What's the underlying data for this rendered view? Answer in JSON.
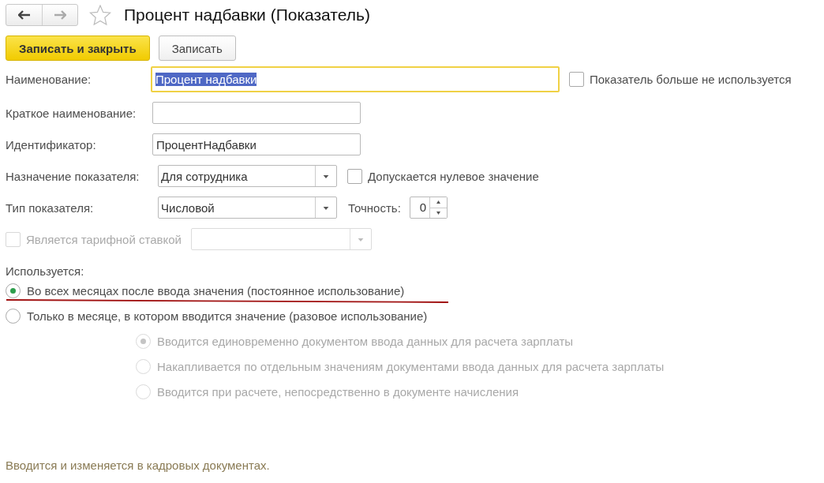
{
  "window": {
    "title": "Процент надбавки (Показатель)",
    "favorite": false
  },
  "buttons": [
    {
      "label": "Записать и закрыть",
      "kind": "primary"
    },
    {
      "label": "Записать",
      "kind": "default"
    }
  ],
  "name": {
    "label": "Наименование:",
    "value": "Процент надбавки",
    "focused": true,
    "text_selected": true
  },
  "not_used": {
    "label": "Показатель больше не используется",
    "checked": false
  },
  "short_name": {
    "label": "Краткое наименование:"
  },
  "identifier": {
    "label": "Идентификатор:",
    "value": "ПроцентНадбавки"
  },
  "purpose": {
    "label": "Назначение показателя:",
    "value": "Для сотрудника"
  },
  "zero_allowed": {
    "label": "Допускается нулевое значение",
    "checked": false
  },
  "type": {
    "label": "Тип показателя:",
    "value": "Числовой"
  },
  "precision": {
    "label": "Точность:",
    "value": "0"
  },
  "tariff": {
    "label": "Является тарифной ставкой",
    "checked": false,
    "disabled": true
  },
  "usage": {
    "label": "Используется:",
    "options": [
      {
        "label": "Во всех месяцах после ввода значения (постоянное использование)",
        "selected": true,
        "underlined": true
      },
      {
        "label": "Только в месяце, в котором вводится значение (разовое использование)",
        "selected": false,
        "underlined": false
      }
    ]
  },
  "entry_mode": {
    "disabled": true,
    "options": [
      {
        "label": "Вводится единовременно документом ввода данных для расчета зарплаты",
        "selected": true
      },
      {
        "label": "Накапливается по отдельным значениям документами ввода данных для расчета зарплаты",
        "selected": false
      },
      {
        "label": "Вводится при расчете, непосредственно в документе начисления",
        "selected": false
      }
    ]
  },
  "footer_note": "Вводится и изменяется в кадровых документах."
}
